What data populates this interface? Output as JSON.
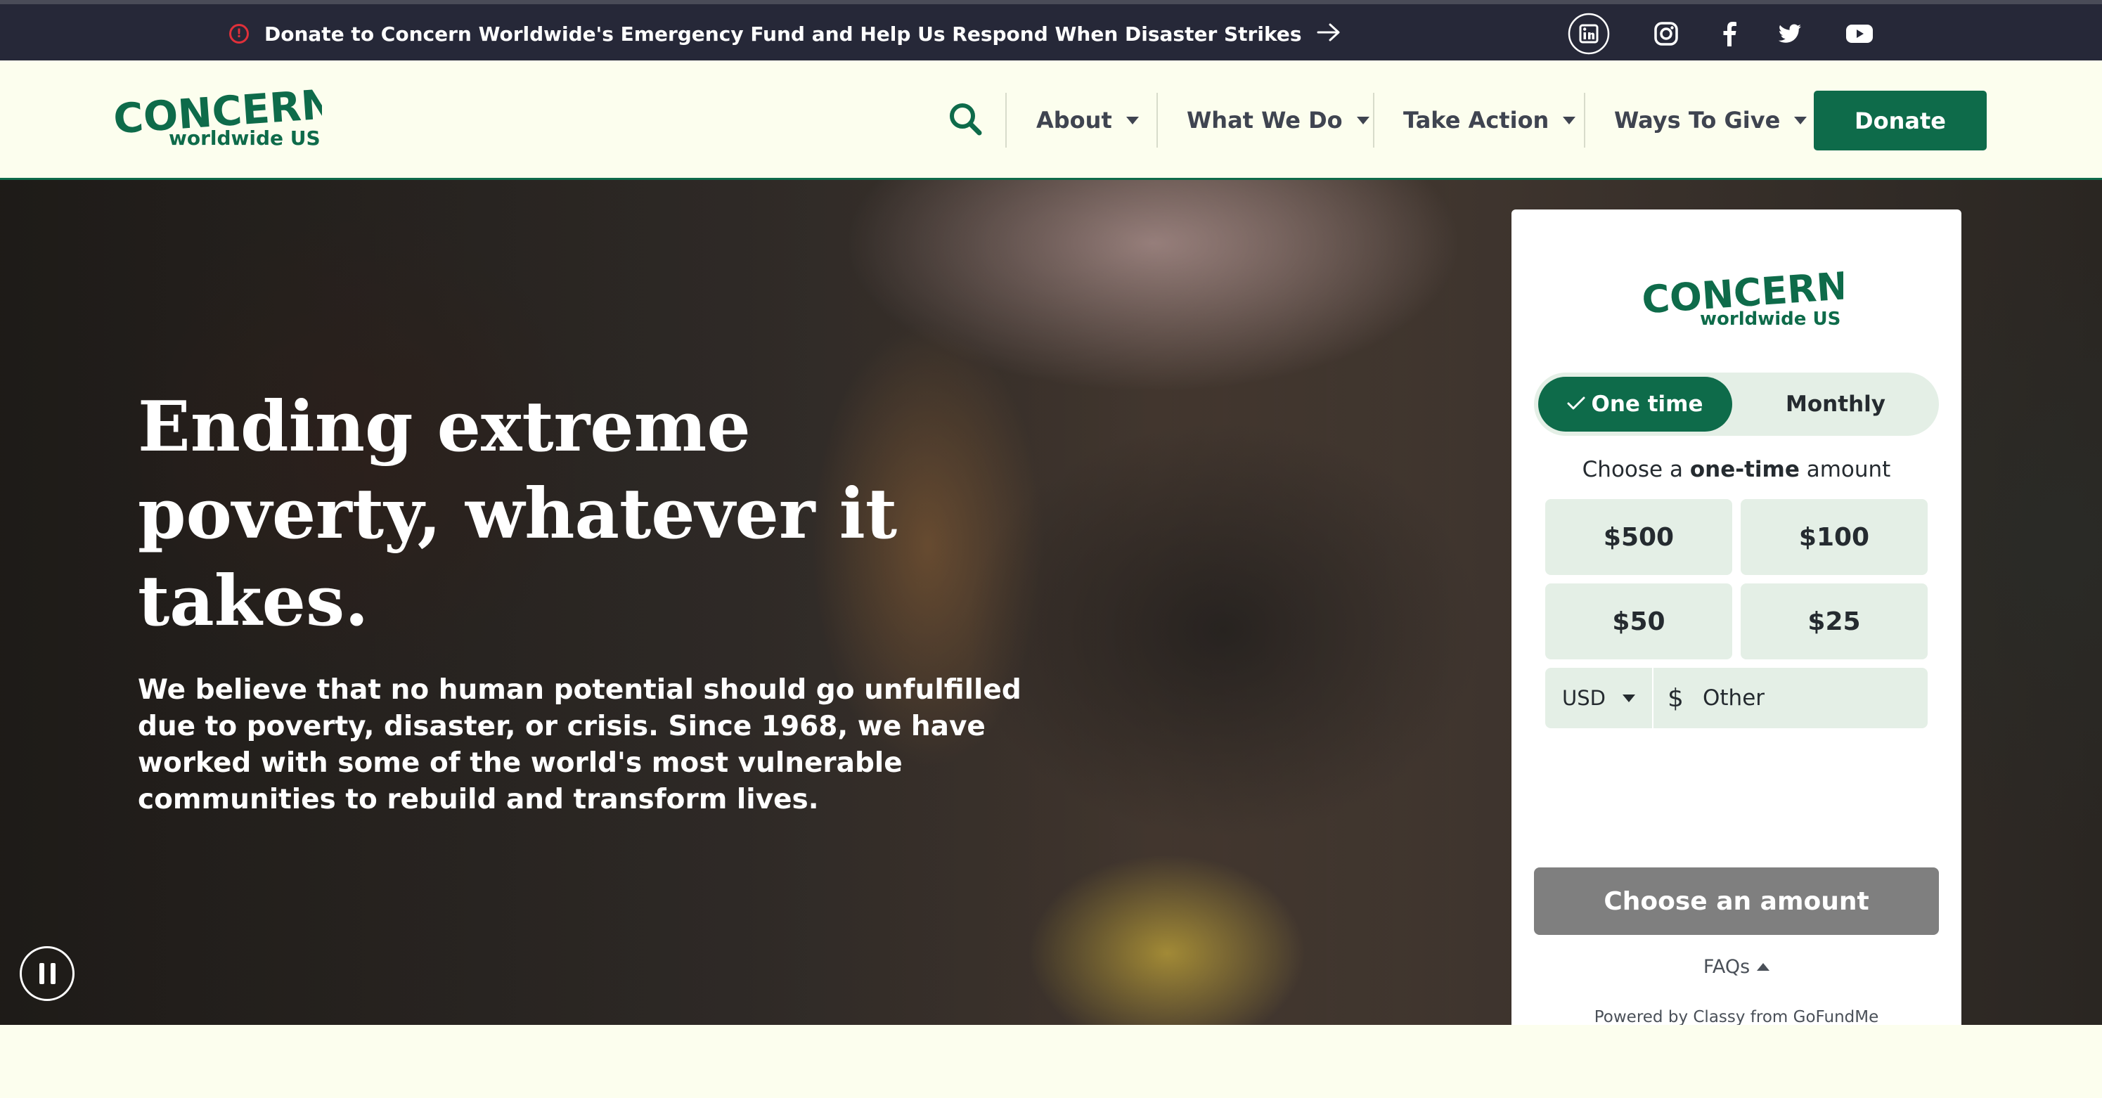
{
  "topbar": {
    "alert_text": "Donate to Concern Worldwide's Emergency Fund and Help Us Respond When Disaster Strikes",
    "alert_icon": "alert-circle-icon",
    "alert_color": "#e0303a",
    "social": [
      "linkedin-icon",
      "instagram-icon",
      "facebook-icon",
      "twitter-icon",
      "youtube-icon"
    ]
  },
  "brand": {
    "name": "CONCERN",
    "tagline": "worldwide US",
    "color": "#0e6b4a"
  },
  "nav": {
    "items": [
      "About",
      "What We Do",
      "Take Action",
      "Ways To Give"
    ],
    "donate_label": "Donate"
  },
  "hero": {
    "title": "Ending extreme poverty, whatever it takes.",
    "text": "We believe that no human potential should go unfulfilled due to poverty, disaster, or crisis. Since 1968, we have worked with some of the world's most vulnerable communities to rebuild and transform lives.",
    "pause_icon": "pause-icon"
  },
  "donation_form": {
    "frequency": {
      "selected": "One time",
      "other": "Monthly"
    },
    "choose_prefix": "Choose a",
    "choose_emphasis": "one-time",
    "choose_suffix": "amount",
    "amounts": [
      "$500",
      "$100",
      "$50",
      "$25"
    ],
    "currency": "USD",
    "currency_symbol": "$",
    "other_placeholder": "Other",
    "submit_label": "Choose an amount",
    "faqs_label": "FAQs",
    "powered_by": "Powered by Classy from GoFundMe"
  }
}
